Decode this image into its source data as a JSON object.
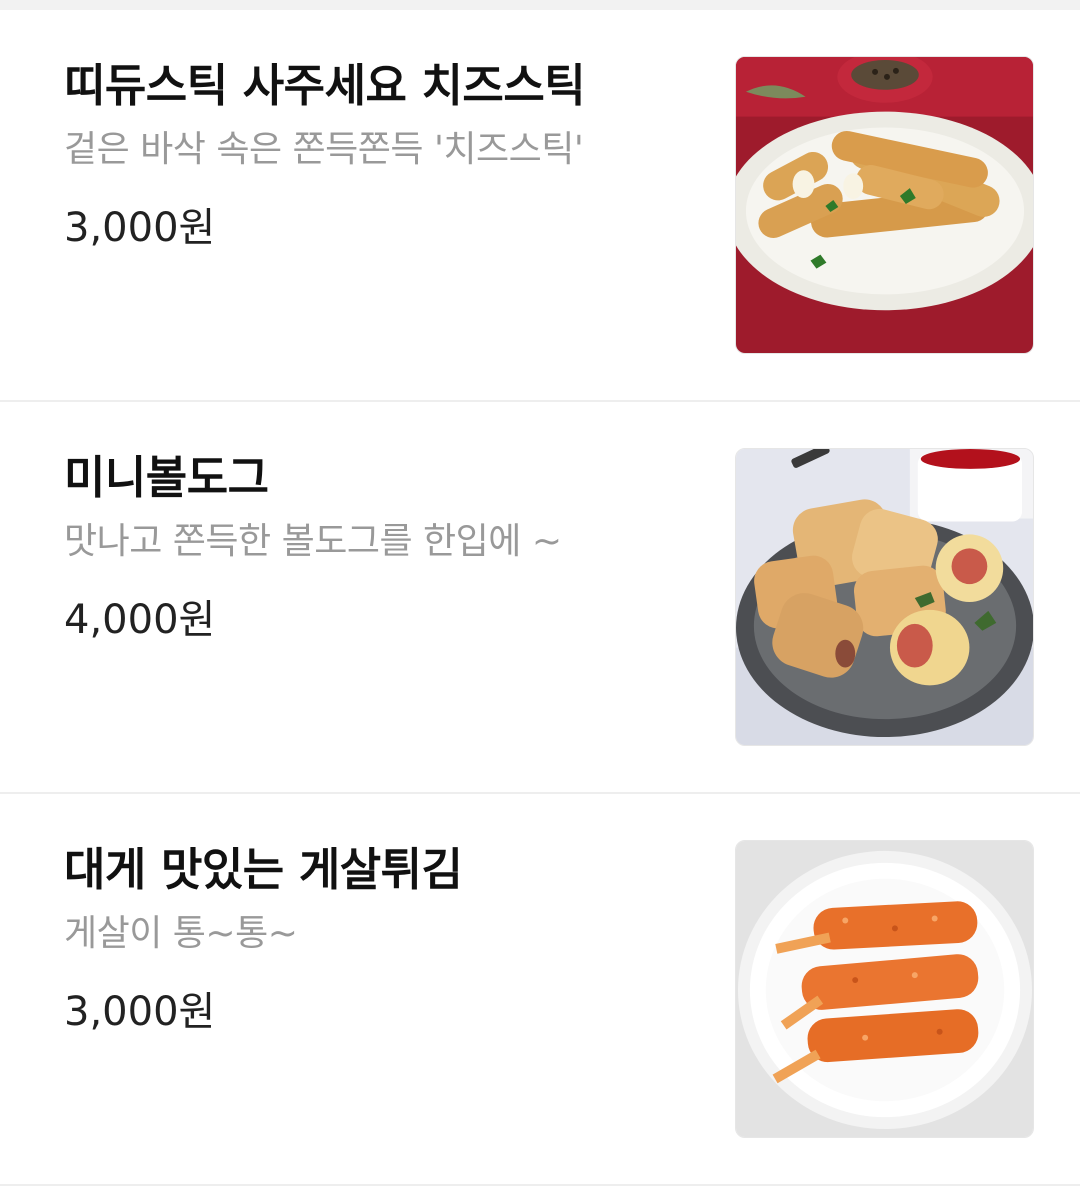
{
  "menu": {
    "items": [
      {
        "name": "띠듀스틱 사주세요 치즈스틱",
        "description": "겉은 바삭 속은 쫀득쫀득 '치즈스틱'",
        "price": "3,000원",
        "photo": "cheese-stick-photo"
      },
      {
        "name": "미니볼도그",
        "description": "맛나고 쫀득한 볼도그를 한입에 ~",
        "price": "4,000원",
        "photo": "mini-ball-dog-photo"
      },
      {
        "name": "대게 맛있는 게살튀김",
        "description": "게살이 통~통~",
        "price": "3,000원",
        "photo": "crab-stick-fry-photo"
      }
    ]
  },
  "colors": {
    "background": "#ffffff",
    "divider": "#eeeeee",
    "name_text": "#111111",
    "description_text": "#999999",
    "price_text": "#222222"
  }
}
